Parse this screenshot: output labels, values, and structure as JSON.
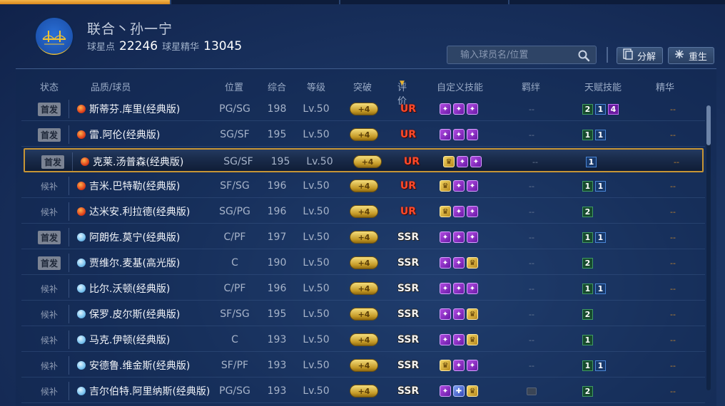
{
  "club": {
    "name": "联合丶孙一宁",
    "points_label": "球星点",
    "points": "22246",
    "essence_label": "球星精华",
    "essence": "13045"
  },
  "search": {
    "placeholder": "输入球员名/位置"
  },
  "actions": {
    "decompose": "分解",
    "reborn": "重生"
  },
  "columns": {
    "status": "状态",
    "player": "品质/球员",
    "position": "位置",
    "overall": "综合",
    "level": "等级",
    "breakthrough": "突破",
    "rating": "评价",
    "custom_skills": "自定义技能",
    "bond": "羁绊",
    "talents": "天赋技能",
    "essence": "精华"
  },
  "rows": [
    {
      "status": "首发",
      "starter": true,
      "quality": "red",
      "name": "斯蒂芬.库里(经典版)",
      "pos": "PG/SG",
      "ovr": "198",
      "lv": "Lv.50",
      "brk": "+4",
      "rating": "UR",
      "skills": [
        "p",
        "p",
        "p"
      ],
      "bond": "--",
      "talents": [
        {
          "v": "2",
          "c": "g"
        },
        {
          "v": "1",
          "c": "b"
        },
        {
          "v": "4",
          "c": "p"
        }
      ],
      "essence": "--"
    },
    {
      "status": "首发",
      "starter": true,
      "quality": "red",
      "name": "雷.阿伦(经典版)",
      "pos": "SG/SF",
      "ovr": "195",
      "lv": "Lv.50",
      "brk": "+4",
      "rating": "UR",
      "skills": [
        "p",
        "p",
        "p"
      ],
      "bond": "--",
      "talents": [
        {
          "v": "1",
          "c": "g"
        },
        {
          "v": "1",
          "c": "b"
        }
      ],
      "essence": "--"
    },
    {
      "status": "首发",
      "starter": true,
      "quality": "red",
      "name": "克莱.汤普森(经典版)",
      "pos": "SG/SF",
      "ovr": "195",
      "lv": "Lv.50",
      "brk": "+4",
      "rating": "UR",
      "skills": [
        "g",
        "p",
        "p"
      ],
      "bond": "--",
      "talents": [
        {
          "v": "1",
          "c": "b"
        }
      ],
      "essence": "--",
      "selected": true
    },
    {
      "status": "候补",
      "starter": false,
      "quality": "red",
      "name": "吉米.巴特勒(经典版)",
      "pos": "SF/SG",
      "ovr": "196",
      "lv": "Lv.50",
      "brk": "+4",
      "rating": "UR",
      "skills": [
        "g",
        "p",
        "p"
      ],
      "bond": "--",
      "talents": [
        {
          "v": "1",
          "c": "g"
        },
        {
          "v": "1",
          "c": "b"
        }
      ],
      "essence": "--"
    },
    {
      "status": "候补",
      "starter": false,
      "quality": "red",
      "name": "达米安.利拉德(经典版)",
      "pos": "SG/PG",
      "ovr": "196",
      "lv": "Lv.50",
      "brk": "+4",
      "rating": "UR",
      "skills": [
        "g",
        "p",
        "p"
      ],
      "bond": "--",
      "talents": [
        {
          "v": "2",
          "c": "g"
        }
      ],
      "essence": "--"
    },
    {
      "status": "首发",
      "starter": true,
      "quality": "blue",
      "name": "阿朗佐.莫宁(经典版)",
      "pos": "C/PF",
      "ovr": "197",
      "lv": "Lv.50",
      "brk": "+4",
      "rating": "SSR",
      "skills": [
        "p",
        "p",
        "p"
      ],
      "bond": "--",
      "talents": [
        {
          "v": "1",
          "c": "g"
        },
        {
          "v": "1",
          "c": "b"
        }
      ],
      "essence": "--"
    },
    {
      "status": "首发",
      "starter": true,
      "quality": "blue",
      "name": "贾维尔.麦基(高光版)",
      "pos": "C",
      "ovr": "190",
      "lv": "Lv.50",
      "brk": "+4",
      "rating": "SSR",
      "skills": [
        "p",
        "p",
        "g"
      ],
      "bond": "--",
      "talents": [
        {
          "v": "2",
          "c": "g"
        }
      ],
      "essence": "--"
    },
    {
      "status": "候补",
      "starter": false,
      "quality": "blue",
      "name": "比尔.沃顿(经典版)",
      "pos": "C/PF",
      "ovr": "196",
      "lv": "Lv.50",
      "brk": "+4",
      "rating": "SSR",
      "skills": [
        "p",
        "p",
        "p"
      ],
      "bond": "--",
      "talents": [
        {
          "v": "1",
          "c": "g"
        },
        {
          "v": "1",
          "c": "b"
        }
      ],
      "essence": "--"
    },
    {
      "status": "候补",
      "starter": false,
      "quality": "blue",
      "name": "保罗.皮尔斯(经典版)",
      "pos": "SF/SG",
      "ovr": "195",
      "lv": "Lv.50",
      "brk": "+4",
      "rating": "SSR",
      "skills": [
        "p",
        "p",
        "g"
      ],
      "bond": "--",
      "talents": [
        {
          "v": "2",
          "c": "g"
        }
      ],
      "essence": "--"
    },
    {
      "status": "候补",
      "starter": false,
      "quality": "blue",
      "name": "马克.伊顿(经典版)",
      "pos": "C",
      "ovr": "193",
      "lv": "Lv.50",
      "brk": "+4",
      "rating": "SSR",
      "skills": [
        "p",
        "p",
        "g"
      ],
      "bond": "--",
      "talents": [
        {
          "v": "1",
          "c": "g"
        }
      ],
      "essence": "--"
    },
    {
      "status": "候补",
      "starter": false,
      "quality": "blue",
      "name": "安德鲁.维金斯(经典版)",
      "pos": "SF/PF",
      "ovr": "193",
      "lv": "Lv.50",
      "brk": "+4",
      "rating": "SSR",
      "skills": [
        "g",
        "p",
        "p"
      ],
      "bond": "--",
      "talents": [
        {
          "v": "1",
          "c": "g"
        },
        {
          "v": "1",
          "c": "b"
        }
      ],
      "essence": "--"
    },
    {
      "status": "候补",
      "starter": false,
      "quality": "blue",
      "name": "吉尔伯特.阿里纳斯(经典版)",
      "pos": "PG/SG",
      "ovr": "193",
      "lv": "Lv.50",
      "brk": "+4",
      "rating": "SSR",
      "skills": [
        "p",
        "b",
        "g"
      ],
      "bond": "",
      "talents": [
        {
          "v": "2",
          "c": "g"
        }
      ],
      "essence": "--"
    }
  ]
}
